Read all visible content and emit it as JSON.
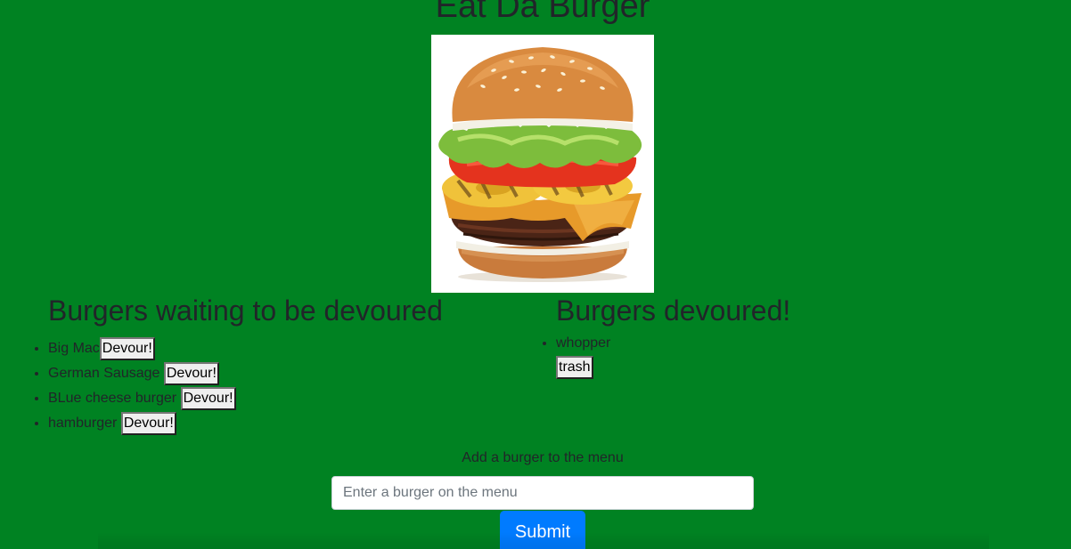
{
  "page": {
    "title": "Eat Da Burger",
    "background_color": "#008222"
  },
  "image": {
    "alt": "burger"
  },
  "waiting": {
    "heading": "Burgers waiting to be devoured",
    "items": [
      {
        "name": "Big Mac",
        "button": "Devour!"
      },
      {
        "name": "German Sausage",
        "button": "Devour!"
      },
      {
        "name": "BLue cheese burger",
        "button": "Devour!"
      },
      {
        "name": "hamburger",
        "button": "Devour!"
      }
    ]
  },
  "devoured": {
    "heading": "Burgers devoured!",
    "items": [
      {
        "name": "whopper",
        "button": "trash"
      }
    ]
  },
  "form": {
    "label": "Add a burger to the menu",
    "placeholder": "Enter a burger on the menu",
    "value": "",
    "submit_label": "Submit",
    "submit_color": "#007bff"
  }
}
